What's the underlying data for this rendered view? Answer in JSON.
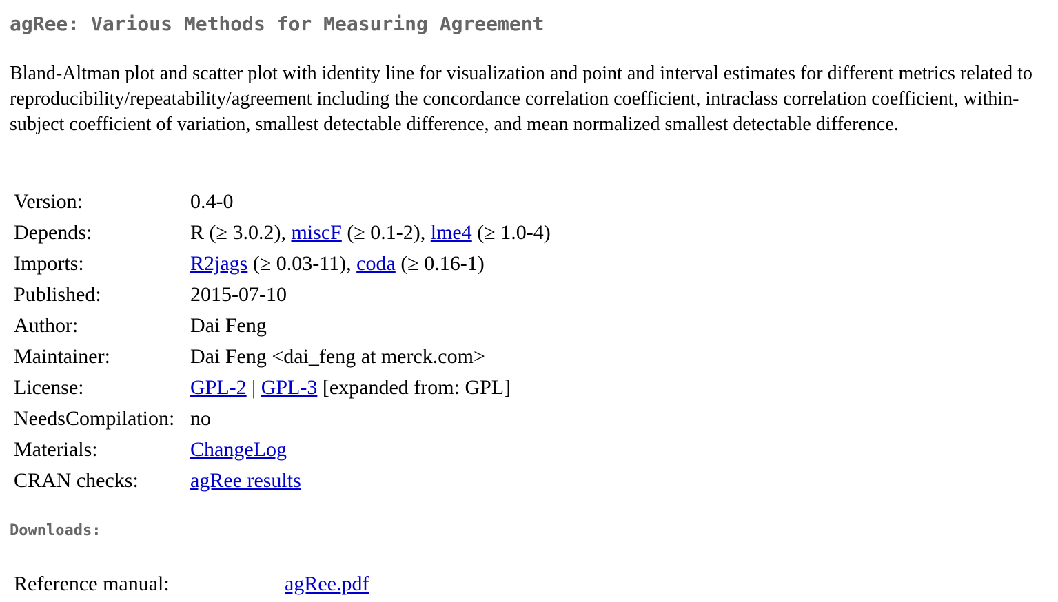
{
  "page": {
    "title": "agRee: Various Methods for Measuring Agreement",
    "description": "Bland-Altman plot and scatter plot with identity line for visualization and point and interval estimates for different metrics related to reproducibility/repeatability/agreement including the concordance correlation coefficient, intraclass correlation coefficient, within-subject coefficient of variation, smallest detectable difference, and mean normalized smallest detectable difference."
  },
  "info": {
    "version": {
      "label": "Version:",
      "value": "0.4-0"
    },
    "depends": {
      "label": "Depends:",
      "r": "R (≥ 3.0.2), ",
      "miscF": "miscF",
      "miscF_ver": " (≥ 0.1-2), ",
      "lme4": "lme4",
      "lme4_ver": " (≥ 1.0-4)"
    },
    "imports": {
      "label": "Imports:",
      "R2jags": "R2jags",
      "R2jags_ver": " (≥ 0.03-11), ",
      "coda": "coda",
      "coda_ver": " (≥ 0.16-1)"
    },
    "published": {
      "label": "Published:",
      "value": "2015-07-10"
    },
    "author": {
      "label": "Author:",
      "value": "Dai Feng"
    },
    "maintainer": {
      "label": "Maintainer:",
      "value": "Dai Feng <dai_feng at merck.com>"
    },
    "license": {
      "label": "License:",
      "gpl2": "GPL-2",
      "sep": " | ",
      "gpl3": "GPL-3",
      "note": " [expanded from: GPL]"
    },
    "needs_compilation": {
      "label": "NeedsCompilation:",
      "value": "no"
    },
    "materials": {
      "label": "Materials:",
      "link": "ChangeLog"
    },
    "cran_checks": {
      "label": "CRAN checks:",
      "link": "agRee results"
    }
  },
  "downloads": {
    "heading": "Downloads:",
    "reference_manual": {
      "label": "Reference manual:",
      "link": "agRee.pdf"
    }
  },
  "colors": {
    "heading": "#666666",
    "link": "#0000cc",
    "text": "#000000",
    "background": "#ffffff"
  }
}
